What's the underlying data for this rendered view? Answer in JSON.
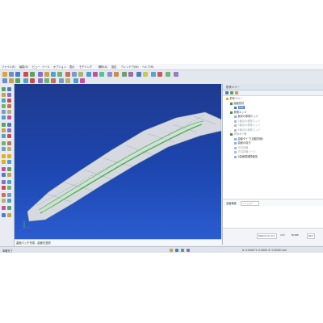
{
  "menubar": {
    "items": [
      "ファイル(F)",
      "編集(E)",
      "ビュー",
      "ツール",
      "オプション",
      "表示",
      "モデリング",
      "解析(A)",
      "設定",
      "ウィンドウ(W)",
      "ヘルプ(H)"
    ]
  },
  "panel": {
    "title": "形状ツリー",
    "tree": [
      {
        "label": "形状ツリー",
        "indent": 0,
        "color": "#f0a020",
        "disabled": false,
        "selected": false
      },
      {
        "label": "曲面形状",
        "indent": 1,
        "color": "#3a8f3a",
        "disabled": false,
        "selected": false
      },
      {
        "label": "曲面",
        "indent": 2,
        "color": "#2f6fd0",
        "disabled": false,
        "selected": true
      },
      {
        "label": "参照エッジ",
        "indent": 1,
        "color": "#3a8f3a",
        "disabled": false,
        "selected": false
      },
      {
        "label": "最初の参照エッジ",
        "indent": 2,
        "color": "#8ab0e0",
        "disabled": false,
        "selected": false
      },
      {
        "label": "2番目の参照エッジ",
        "indent": 2,
        "color": "#b0b8c4",
        "disabled": true,
        "selected": false
      },
      {
        "label": "3番目の参照エッジ",
        "indent": 2,
        "color": "#b0b8c4",
        "disabled": true,
        "selected": false
      },
      {
        "label": "4番目の参照エッジ",
        "indent": 2,
        "color": "#b0b8c4",
        "disabled": true,
        "selected": false
      },
      {
        "label": "パラメータ",
        "indent": 1,
        "color": "#3a8f3a",
        "disabled": false,
        "selected": false
      },
      {
        "label": "曲面タイプ(自動評価)",
        "indent": 2,
        "color": "#8ab0e0",
        "disabled": false,
        "selected": false
      },
      {
        "label": "曲面の向き",
        "indent": 2,
        "color": "#8ab0e0",
        "disabled": false,
        "selected": false
      },
      {
        "label": "方向評価",
        "indent": 2,
        "color": "#b0b8c4",
        "disabled": true,
        "selected": false
      },
      {
        "label": "方向評価ツール",
        "indent": 2,
        "color": "#b0b8c4",
        "disabled": true,
        "selected": false
      },
      {
        "label": "2曲線間補間使用",
        "indent": 2,
        "color": "#8ab0e0",
        "disabled": false,
        "selected": false
      }
    ],
    "search_label": "全面検索",
    "search_placeholder": "フィルター",
    "bottom": {
      "tolerance_label": "Maximum 0.1",
      "tolerance_unit": "mm",
      "value_label": "NURB",
      "mode_label": "Part"
    }
  },
  "viewport_status": "曲面パッチ作成 - 曲面を選択",
  "statusbar": {
    "left": "準備完了",
    "right": "X: 0.0000  Y: 0.0000  Z: 0.0000  mm"
  },
  "colors": {
    "viewport_top": "#1e3a8f",
    "viewport_bottom": "#2a5cd0",
    "surface": "#d4d8de",
    "curve": "#4caf50",
    "selection": "#2f6fd0"
  }
}
